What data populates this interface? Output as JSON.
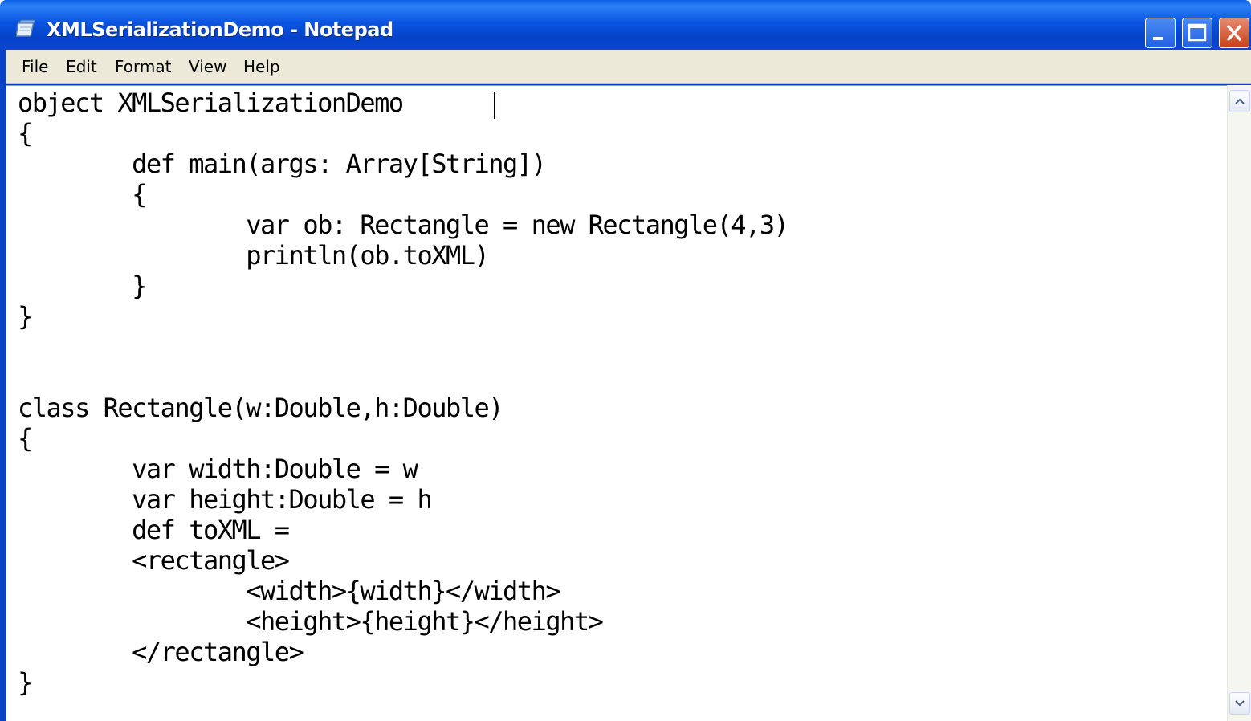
{
  "window": {
    "title": "XMLSerializationDemo - Notepad",
    "icon": "notepad-icon"
  },
  "menu": {
    "file": "File",
    "edit": "Edit",
    "format": "Format",
    "view": "View",
    "help": "Help"
  },
  "editor": {
    "content": "object XMLSerializationDemo\n{\n\tdef main(args: Array[String])\n\t{\n\t\tvar ob: Rectangle = new Rectangle(4,3)\n\t\tprintln(ob.toXML)\n\t}\n}\n\n\nclass Rectangle(w:Double,h:Double)\n{\n\tvar width:Double = w\n\tvar height:Double = h\n\tdef toXML =\n\t<rectangle>\n\t\t<width>{width}</width>\n\t\t<height>{height}</height>\n\t</rectangle>\n}"
  },
  "controls": {
    "minimize": "minimize-icon",
    "maximize": "maximize-icon",
    "close": "close-icon"
  },
  "colors": {
    "titlebar": "#0b54e0",
    "close": "#c8401a",
    "menubar": "#ece9d8"
  }
}
